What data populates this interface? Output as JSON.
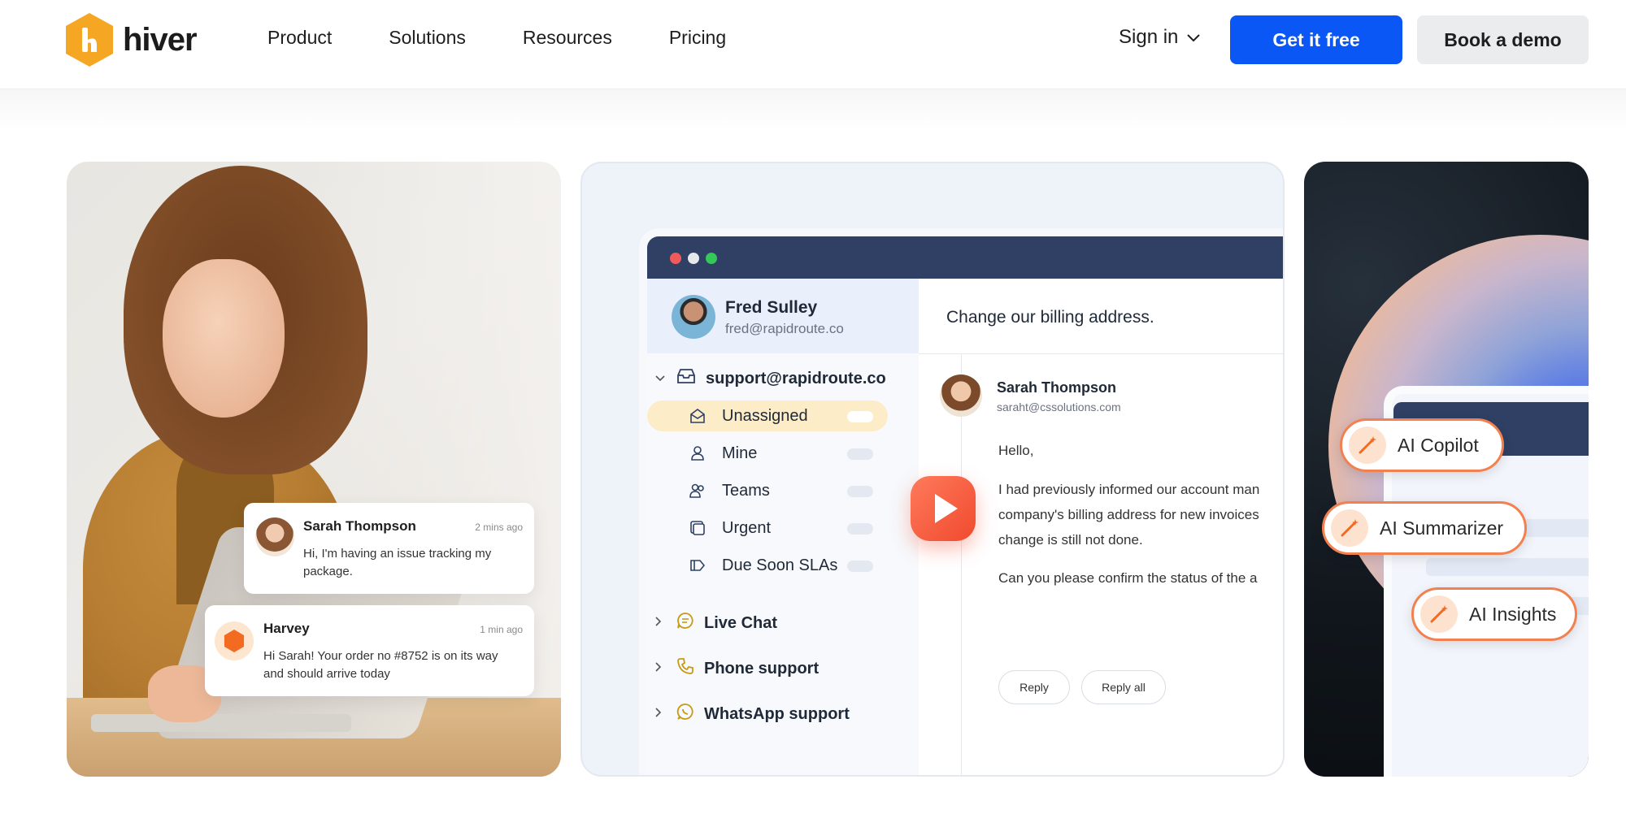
{
  "brand": {
    "name": "hiver",
    "accent": "#f5a623",
    "primary_blue": "#0a57f5"
  },
  "nav": {
    "links": [
      "Product",
      "Solutions",
      "Resources",
      "Pricing"
    ],
    "signin": "Sign in",
    "cta_primary": "Get it free",
    "cta_secondary": "Book a demo"
  },
  "photo_card": {
    "messages": [
      {
        "name": "Sarah Thompson",
        "time": "2 mins ago",
        "text": "Hi, I'm having an issue tracking my package."
      },
      {
        "name": "Harvey",
        "time": "1 min ago",
        "text": "Hi Sarah! Your order no #8752 is on its way and should arrive today"
      }
    ]
  },
  "app_card": {
    "profile": {
      "name": "Fred Sulley",
      "email": "fred@rapidroute.co"
    },
    "inbox": "support@rapidroute.co",
    "folders": [
      {
        "label": "Unassigned",
        "icon": "mail-open-icon"
      },
      {
        "label": "Mine",
        "icon": "user-icon"
      },
      {
        "label": "Teams",
        "icon": "users-icon"
      },
      {
        "label": "Urgent",
        "icon": "urgent-icon"
      },
      {
        "label": "Due Soon SLAs",
        "icon": "tag-icon"
      }
    ],
    "groups": [
      {
        "label": "Live Chat",
        "icon": "chat-icon"
      },
      {
        "label": "Phone support",
        "icon": "phone-icon"
      },
      {
        "label": "WhatsApp support",
        "icon": "whatsapp-icon"
      }
    ],
    "email": {
      "subject": "Change our billing address.",
      "from_name": "Sarah Thompson",
      "from_email": "saraht@cssolutions.com",
      "greeting": "Hello,",
      "body_lines": [
        "I had previously informed our account man",
        "company's billing address for new invoices",
        "change is still not done."
      ],
      "closing": "Can you please confirm the status of the a",
      "reply": "Reply",
      "reply_all": "Reply all"
    }
  },
  "ai_card": {
    "chips": [
      "AI Copilot",
      "AI Summarizer",
      "AI Insights"
    ]
  }
}
